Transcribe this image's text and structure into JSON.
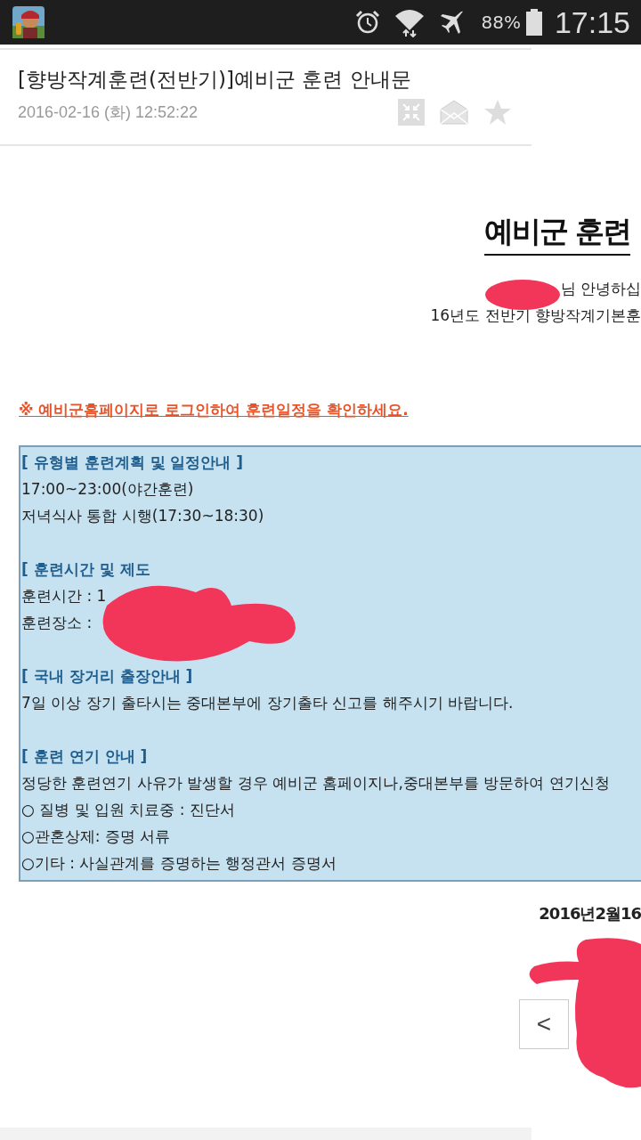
{
  "status_bar": {
    "battery": "88%",
    "time": "17:15"
  },
  "message": {
    "subject": "[향방작계훈련(전반기)]예비군 훈련 안내문",
    "date": "2016-02-16 (화) 12:52:22"
  },
  "body": {
    "title": "예비군 훈련",
    "greeting": "님 안녕하십",
    "intro": "16년도 전반기 향방작계기본훈",
    "notice": "※ 예비군홈페이지로 로그인하여 훈련일정을 확인하세요.",
    "box_lines": [
      {
        "kind": "heading",
        "text": "[ 유형별 훈련계획 및 일정안내 ]"
      },
      {
        "kind": "text",
        "text": "17:00~23:00(야간훈련)"
      },
      {
        "kind": "text",
        "text": "저녁식사 통합 시행(17:30~18:30)"
      },
      {
        "kind": "blank"
      },
      {
        "kind": "heading",
        "text": "[ 훈련시간 및 제도"
      },
      {
        "kind": "text",
        "text": "훈련시간 : 1"
      },
      {
        "kind": "text",
        "text": "훈련장소 :"
      },
      {
        "kind": "blank"
      },
      {
        "kind": "heading",
        "text": "[ 국내 장거리 출장안내 ]"
      },
      {
        "kind": "text",
        "text": "7일 이상 장기 출타시는 중대본부에 장기출타 신고를 해주시기 바랍니다."
      },
      {
        "kind": "blank"
      },
      {
        "kind": "heading",
        "text": "[ 훈련 연기 안내 ]"
      },
      {
        "kind": "text",
        "text": "정당한 훈련연기 사유가 발생할 경우 예비군 홈페이지나,중대본부를 방문하여 연기신청"
      },
      {
        "kind": "text",
        "text": "○ 질병 및 입원 치료중 : 진단서"
      },
      {
        "kind": "text",
        "text": "○관혼상제: 증명 서류"
      },
      {
        "kind": "text",
        "text": "○기타 : 사실관계를 증명하는 행정관서 증명서"
      }
    ],
    "sign_date": "2016년2월16"
  },
  "pager": {
    "previous": "<"
  }
}
